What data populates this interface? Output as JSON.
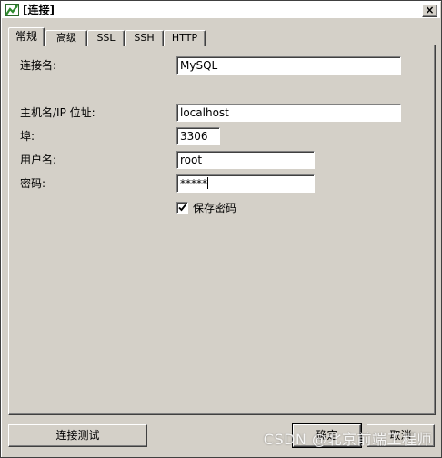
{
  "window": {
    "title": "[连接]",
    "close_label": "×"
  },
  "tabs": [
    {
      "label": "常规",
      "active": true
    },
    {
      "label": "高级",
      "active": false
    },
    {
      "label": "SSL",
      "active": false
    },
    {
      "label": "SSH",
      "active": false
    },
    {
      "label": "HTTP",
      "active": false
    }
  ],
  "form": {
    "connection_name": {
      "label": "连接名:",
      "value": "MySQL"
    },
    "host": {
      "label": "主机名/IP 位址:",
      "value": "localhost"
    },
    "port": {
      "label": "埠:",
      "value": "3306"
    },
    "username": {
      "label": "用户名:",
      "value": "root"
    },
    "password": {
      "label": "密码:",
      "value": "*****"
    },
    "save_password": {
      "label": "保存密码",
      "checked": true
    }
  },
  "buttons": {
    "test": "连接测试",
    "ok": "确定",
    "cancel": "取消"
  },
  "watermark": "CSDN @北京前端工程师",
  "icons": {
    "title": "app-icon",
    "close": "close-icon",
    "check": "checkmark-icon"
  }
}
